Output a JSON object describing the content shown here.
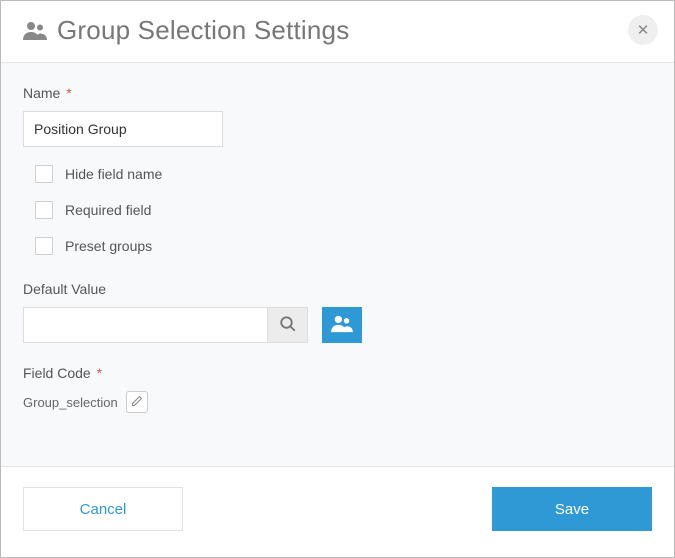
{
  "header": {
    "title": "Group Selection Settings"
  },
  "form": {
    "name_label": "Name",
    "name_value": "Position Group",
    "hide_field_label": "Hide field name",
    "required_field_label": "Required field",
    "preset_groups_label": "Preset groups",
    "default_value_label": "Default Value",
    "default_value": "",
    "field_code_label": "Field Code",
    "field_code_value": "Group_selection"
  },
  "footer": {
    "cancel_label": "Cancel",
    "save_label": "Save"
  }
}
